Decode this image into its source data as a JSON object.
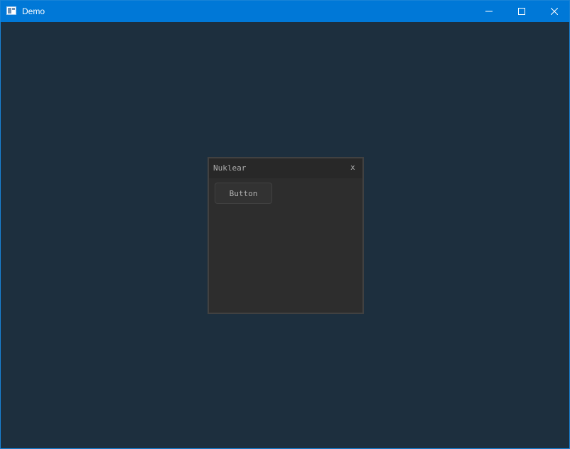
{
  "window": {
    "title": "Demo",
    "icon": "app-window-icon",
    "controls": {
      "minimize_icon": "minimize-icon",
      "maximize_icon": "maximize-icon",
      "close_icon": "close-icon"
    }
  },
  "nuklear": {
    "title": "Nuklear",
    "close_label": "x",
    "button_label": "Button"
  },
  "colors": {
    "titlebar": "#0078d7",
    "background": "#1d2f3e",
    "panel": "#2d2d2d",
    "panel_header": "#282828",
    "panel_border": "#414141",
    "text": "#afafaf"
  }
}
